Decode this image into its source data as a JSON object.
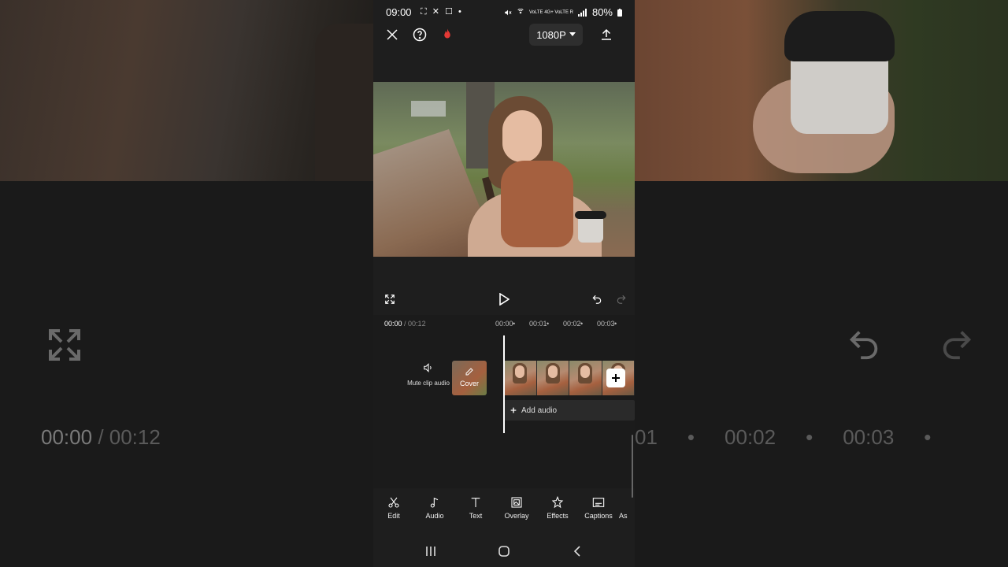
{
  "status": {
    "time": "09:00",
    "left_icons": "⛶ ✕ ☐ •",
    "signal_text": "VoLTE 4G+ VoLTE R",
    "battery": "80%"
  },
  "topbar": {
    "resolution": "1080P"
  },
  "timeline": {
    "current_time": "00:00",
    "total_time": "/ 00:12",
    "ruler": [
      "00:00",
      "•",
      "00:01",
      "•",
      "00:02",
      "•",
      "00:03",
      "•"
    ],
    "mute_label": "Mute clip audio",
    "cover_label": "Cover",
    "add_audio": "Add audio"
  },
  "toolbar": {
    "items": [
      {
        "label": "Edit",
        "icon": "scissors-icon"
      },
      {
        "label": "Audio",
        "icon": "music-note-icon"
      },
      {
        "label": "Text",
        "icon": "text-icon"
      },
      {
        "label": "Overlay",
        "icon": "overlay-icon"
      },
      {
        "label": "Effects",
        "icon": "effects-icon"
      },
      {
        "label": "Captions",
        "icon": "captions-icon"
      },
      {
        "label": "As",
        "icon": "aspect-icon"
      }
    ]
  },
  "background": {
    "time_current": "00:00",
    "time_total": "/ 00:12",
    "ruler_tail": [
      "01",
      "•",
      "00:02",
      "•",
      "00:03",
      "•"
    ]
  },
  "colors": {
    "phone_bg": "#1e1e1e",
    "page_bg": "#121212",
    "fire_accent": "#e53935"
  }
}
